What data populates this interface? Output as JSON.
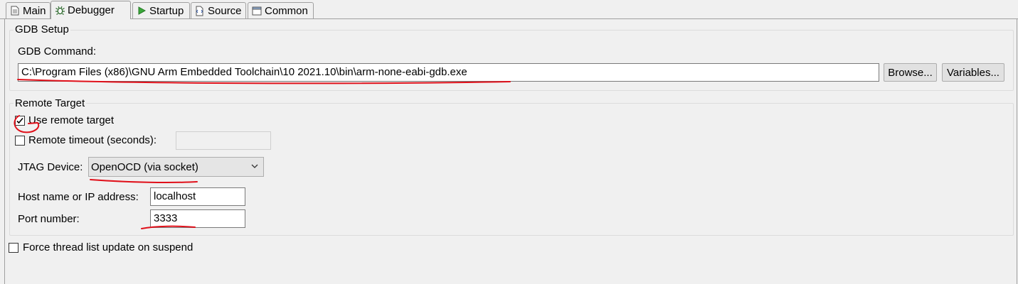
{
  "tabs": [
    {
      "label": "Main",
      "icon": "document-icon",
      "active": false
    },
    {
      "label": "Debugger",
      "icon": "bug-icon",
      "active": true
    },
    {
      "label": "Startup",
      "icon": "play-icon",
      "active": false
    },
    {
      "label": "Source",
      "icon": "source-icon",
      "active": false
    },
    {
      "label": "Common",
      "icon": "window-icon",
      "active": false
    }
  ],
  "gdb_setup": {
    "title": "GDB Setup",
    "command_label": "GDB Command:",
    "command_value": "C:\\Program Files (x86)\\GNU Arm Embedded Toolchain\\10 2021.10\\bin\\arm-none-eabi-gdb.exe",
    "browse_label": "Browse...",
    "variables_label": "Variables..."
  },
  "remote_target": {
    "title": "Remote Target",
    "use_remote_label": "Use remote target",
    "use_remote_checked": true,
    "timeout_label": "Remote timeout (seconds):",
    "timeout_checked": false,
    "timeout_value": "",
    "jtag_label": "JTAG Device:",
    "jtag_value": "OpenOCD (via socket)",
    "host_label": "Host name or IP address:",
    "host_value": "localhost",
    "port_label": "Port number:",
    "port_value": "3333"
  },
  "force_thread": {
    "label": "Force thread list update on suspend",
    "checked": false
  },
  "colors": {
    "annotation_red": "#e0101a",
    "background": "#f0f0f0"
  }
}
